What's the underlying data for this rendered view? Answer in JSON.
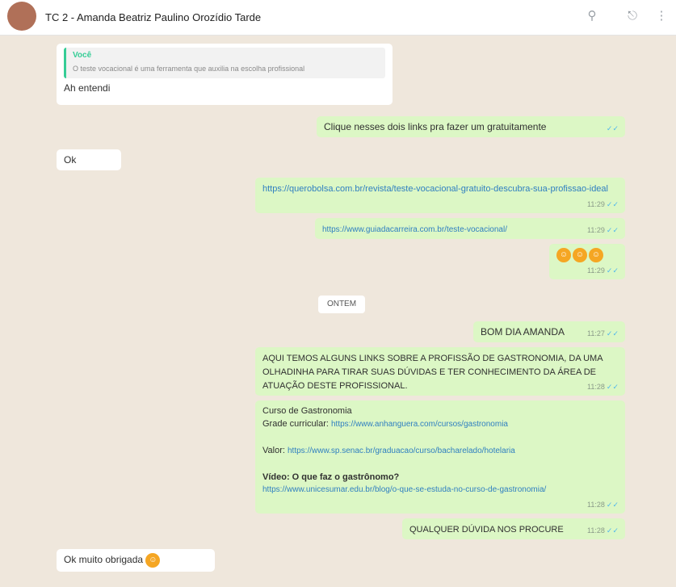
{
  "header": {
    "title": "TC 2 - Amanda Beatriz Paulino Orozídio Tarde",
    "search_icon": "search-icon",
    "attach_icon": "paperclip-icon",
    "menu_icon": "more-vertical-icon"
  },
  "messages": {
    "m1_quote_author": "Você",
    "m1_quote_text": "O teste vocacional é uma ferramenta que auxilia na escolha profissional",
    "m1_text": "Ah entendi",
    "m2_text": "Clique nesses dois links pra fazer um gratuitamente",
    "m3_text": "Ok",
    "m4_text": "https://querobolsa.com.br/revista/teste-vocacional-gratuito-descubra-sua-profissao-ideal",
    "m4_time": "11:29",
    "m5_text": "https://www.guiadacarreira.com.br/teste-vocacional/",
    "m5_time": "11:29",
    "m6_time": "11:29",
    "divider": "ONTEM",
    "m7_text": "BOM DIA AMANDA",
    "m7_time": "11:27",
    "m8_text": "AQUI TEMOS ALGUNS LINKS SOBRE A PROFISSÃO DE GASTRONOMIA, DA UMA OLHADINHA PARA TIRAR SUAS DÚVIDAS E TER CONHECIMENTO DA ÁREA DE ATUAÇÃO DESTE PROFISSIONAL.",
    "m8_time": "11:28",
    "m9_line1": "Curso de Gastronomia",
    "m9_grade_label": "Grade curricular:",
    "m9_grade_link": "https://www.anhanguera.com/cursos/gastronomia",
    "m9_valor_label": "Valor:",
    "m9_valor_link": "https://www.sp.senac.br/graduacao/curso/bacharelado/hotelaria",
    "m9_video_label": "Vídeo: O que faz o gastrônomo?",
    "m9_video_link": "https://www.unicesumar.edu.br/blog/o-que-se-estuda-no-curso-de-gastronomia/",
    "m9_time": "11:28",
    "m10_text": "QUALQUER DÚVIDA NOS PROCURE",
    "m10_time": "11:28",
    "m11_text": "Ok muito obrigada"
  },
  "colors": {
    "incoming": "#ffffff",
    "outgoing": "#dcf7c5",
    "read_tick": "#4fb6ec",
    "link": "#2f7fc0"
  }
}
